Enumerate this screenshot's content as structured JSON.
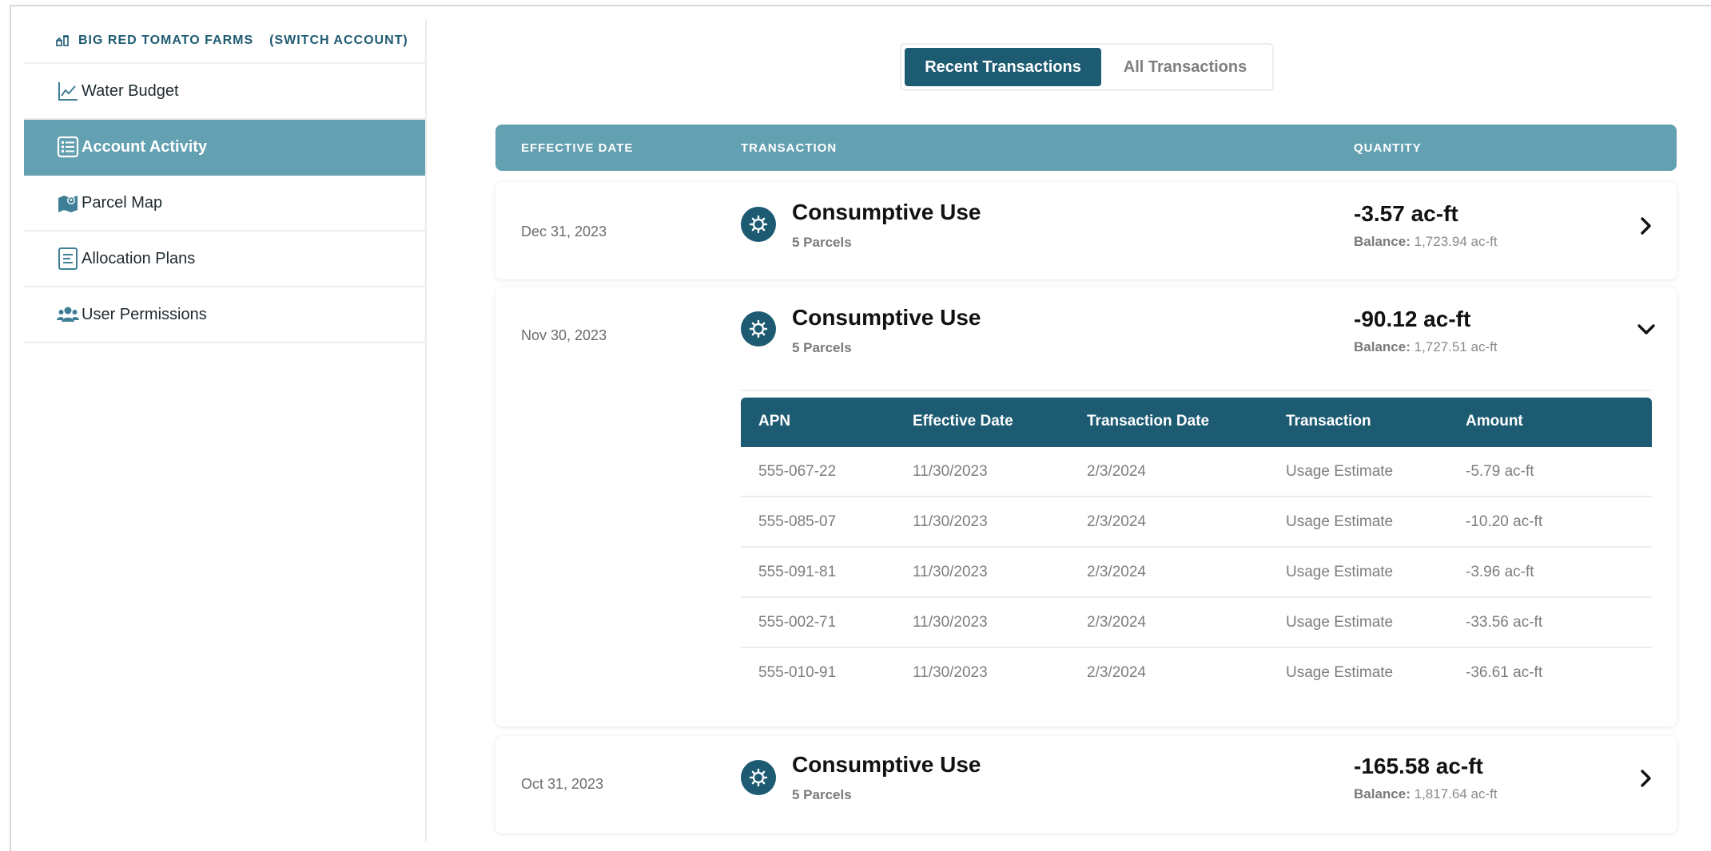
{
  "account": {
    "name": "BIG RED TOMATO FARMS",
    "switch_label": "(SWITCH ACCOUNT)"
  },
  "sidebar": {
    "items": [
      {
        "label": "Water Budget",
        "icon": "line-chart-icon",
        "active": false
      },
      {
        "label": "Account Activity",
        "icon": "list-icon",
        "active": true
      },
      {
        "label": "Parcel Map",
        "icon": "map-icon",
        "active": false
      },
      {
        "label": "Allocation Plans",
        "icon": "document-icon",
        "active": false
      },
      {
        "label": "User Permissions",
        "icon": "users-icon",
        "active": false
      }
    ]
  },
  "tabs": {
    "recent": "Recent Transactions",
    "all": "All Transactions",
    "selected": "recent"
  },
  "columns": {
    "effective_date": "EFFECTIVE DATE",
    "transaction": "TRANSACTION",
    "quantity": "QUANTITY"
  },
  "transactions": [
    {
      "date": "Dec 31, 2023",
      "title": "Consumptive Use",
      "parcels": "5 Parcels",
      "quantity": "-3.57 ac-ft",
      "balance_label": "Balance:",
      "balance": "1,723.94 ac-ft",
      "expanded": false
    },
    {
      "date": "Nov 30, 2023",
      "title": "Consumptive Use",
      "parcels": "5 Parcels",
      "quantity": "-90.12 ac-ft",
      "balance_label": "Balance:",
      "balance": "1,727.51 ac-ft",
      "expanded": true,
      "detail": {
        "headers": [
          "APN",
          "Effective Date",
          "Transaction Date",
          "Transaction",
          "Amount"
        ],
        "rows": [
          [
            "555-067-22",
            "11/30/2023",
            "2/3/2024",
            "Usage Estimate",
            "-5.79 ac-ft"
          ],
          [
            "555-085-07",
            "11/30/2023",
            "2/3/2024",
            "Usage Estimate",
            "-10.20 ac-ft"
          ],
          [
            "555-091-81",
            "11/30/2023",
            "2/3/2024",
            "Usage Estimate",
            "-3.96 ac-ft"
          ],
          [
            "555-002-71",
            "11/30/2023",
            "2/3/2024",
            "Usage Estimate",
            "-33.56 ac-ft"
          ],
          [
            "555-010-91",
            "11/30/2023",
            "2/3/2024",
            "Usage Estimate",
            "-36.61 ac-ft"
          ]
        ]
      }
    },
    {
      "date": "Oct 31, 2023",
      "title": "Consumptive Use",
      "parcels": "5 Parcels",
      "quantity": "-165.58 ac-ft",
      "balance_label": "Balance:",
      "balance": "1,817.64 ac-ft",
      "expanded": false
    }
  ],
  "colors": {
    "primary": "#1d5b73",
    "accent": "#63a0b1"
  }
}
